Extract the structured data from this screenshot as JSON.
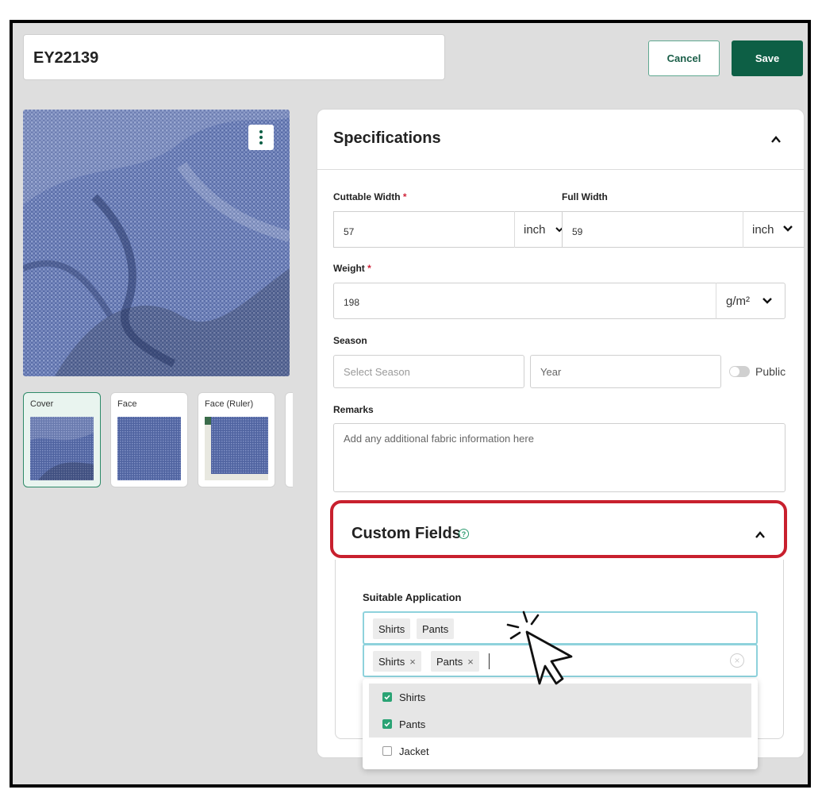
{
  "header": {
    "title": "EY22139",
    "cancel_label": "Cancel",
    "save_label": "Save"
  },
  "gallery": {
    "thumbnails": [
      {
        "label": "Cover",
        "active": true
      },
      {
        "label": "Face",
        "active": false
      },
      {
        "label": "Face (Ruler)",
        "active": false
      }
    ]
  },
  "specifications": {
    "title": "Specifications",
    "cuttable_width": {
      "label": "Cuttable Width",
      "required": "*",
      "value": "57",
      "unit": "inch"
    },
    "full_width": {
      "label": "Full Width",
      "value": "59",
      "unit": "inch"
    },
    "weight": {
      "label": "Weight",
      "required": "*",
      "value": "198",
      "unit": "g/m²"
    },
    "season": {
      "label": "Season",
      "season_placeholder": "Select Season",
      "year_placeholder": "Year",
      "public_label": "Public"
    },
    "remarks": {
      "label": "Remarks",
      "placeholder": "Add any additional fabric information here"
    }
  },
  "custom_fields": {
    "title": "Custom Fields",
    "suitable_application": {
      "label": "Suitable Application",
      "display_tags": [
        "Shirts",
        "Pants"
      ],
      "selected_tags": [
        "Shirts",
        "Pants"
      ],
      "options": [
        {
          "label": "Shirts",
          "checked": true
        },
        {
          "label": "Pants",
          "checked": true
        },
        {
          "label": "Jacket",
          "checked": false
        }
      ]
    }
  },
  "colors": {
    "accent": "#0d5f45",
    "checkbox": "#2aa374",
    "highlight": "#c8202e",
    "fabric": "#5c6fa8"
  }
}
